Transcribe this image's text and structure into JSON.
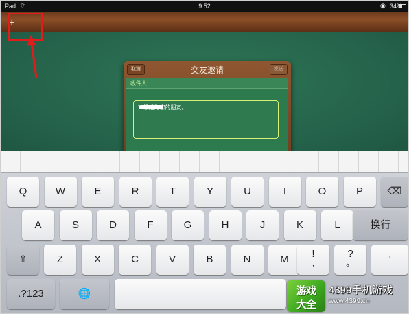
{
  "status_bar": {
    "device": "Pad",
    "time": "9:52",
    "battery_text": "34%",
    "battery_level": 0.34
  },
  "toolbar": {
    "add_label": "+"
  },
  "dialog": {
    "title": "交友邀请",
    "cancel_label": "取消",
    "send_label": "发送",
    "recipient_label": "收件人:",
    "message_text": "“          ”想成为您的朋友。"
  },
  "keyboard": {
    "row1": [
      "Q",
      "W",
      "E",
      "R",
      "T",
      "Y",
      "U",
      "I",
      "O",
      "P"
    ],
    "row2": [
      "A",
      "S",
      "D",
      "F",
      "G",
      "H",
      "J",
      "K",
      "L"
    ],
    "return_label": "换行",
    "row3": [
      "Z",
      "X",
      "C",
      "V",
      "B",
      "N",
      "M"
    ],
    "punct1_top": "!",
    "punct1_bottom": ",",
    "punct2_top": "?",
    "punct2_bottom": "。",
    "punct3": "’",
    "numbers_label": ".?123"
  },
  "watermark": {
    "logo_line1": "游戏",
    "logo_line2": "大全",
    "site_name": "4399手机游戏",
    "url": "www.4399.cn"
  },
  "colors": {
    "felt": "#2a6a4d",
    "wood": "#7a4522",
    "highlight": "#e21b1b"
  }
}
